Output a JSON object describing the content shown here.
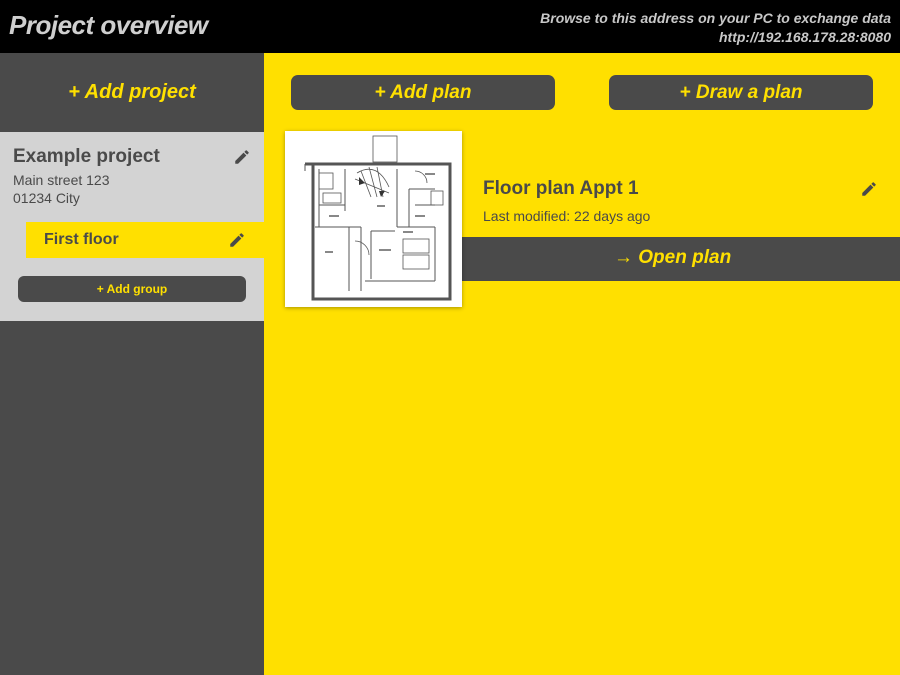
{
  "header": {
    "title": "Project overview",
    "address_hint": "Browse to this address on your PC to exchange data",
    "address_url": "http://192.168.178.28:8080"
  },
  "sidebar": {
    "add_project_label": "+ Add project",
    "project": {
      "name": "Example project",
      "street": "Main street 123",
      "city": "01234 City",
      "edit_icon": "pencil-icon"
    },
    "groups": [
      {
        "label": "First floor",
        "selected": true,
        "edit_icon": "pencil-icon"
      }
    ],
    "add_group_label": "+ Add group"
  },
  "toolbar": {
    "add_plan_label": "+ Add plan",
    "draw_plan_label": "+ Draw a plan"
  },
  "plans": [
    {
      "name": "Floor plan Appt 1",
      "last_modified": "Last modified: 22 days ago",
      "open_label": "→ Open plan",
      "thumbnail": "floor-plan-thumbnail",
      "edit_icon": "pencil-icon"
    }
  ],
  "colors": {
    "accent": "#ffe000",
    "dark": "#4a4a4a",
    "card": "#d3d3d3",
    "header": "#000000"
  }
}
